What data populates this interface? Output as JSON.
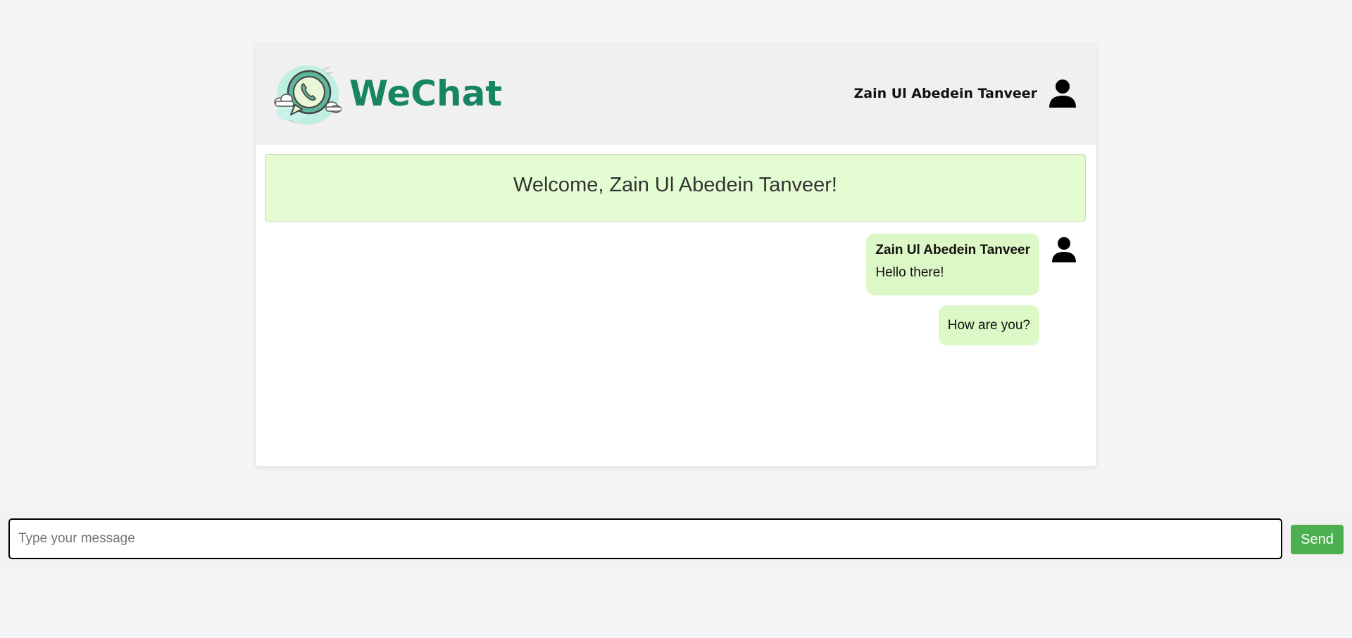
{
  "header": {
    "brand": "WeChat",
    "user_name": "Zain Ul Abedein Tanveer",
    "logo_icon": "whatsapp-phone-bubble-logo",
    "user_icon": "person-icon"
  },
  "welcome": {
    "text": "Welcome, Zain Ul Abedein Tanveer!"
  },
  "messages": [
    {
      "sender": "Zain Ul Abedein Tanveer",
      "text": "Hello there!",
      "avatar_icon": "person-icon"
    },
    {
      "text": "How are you?"
    }
  ],
  "composer": {
    "placeholder": "Type your message",
    "value": "",
    "send_label": "Send"
  },
  "colors": {
    "brand": "#178563",
    "welcome_bg": "#e4fcd2",
    "bubble_bg": "#dcf8c6",
    "send_button": "#4caf50",
    "header_bg": "#f0f0f0",
    "page_bg": "#f4f4f4"
  }
}
